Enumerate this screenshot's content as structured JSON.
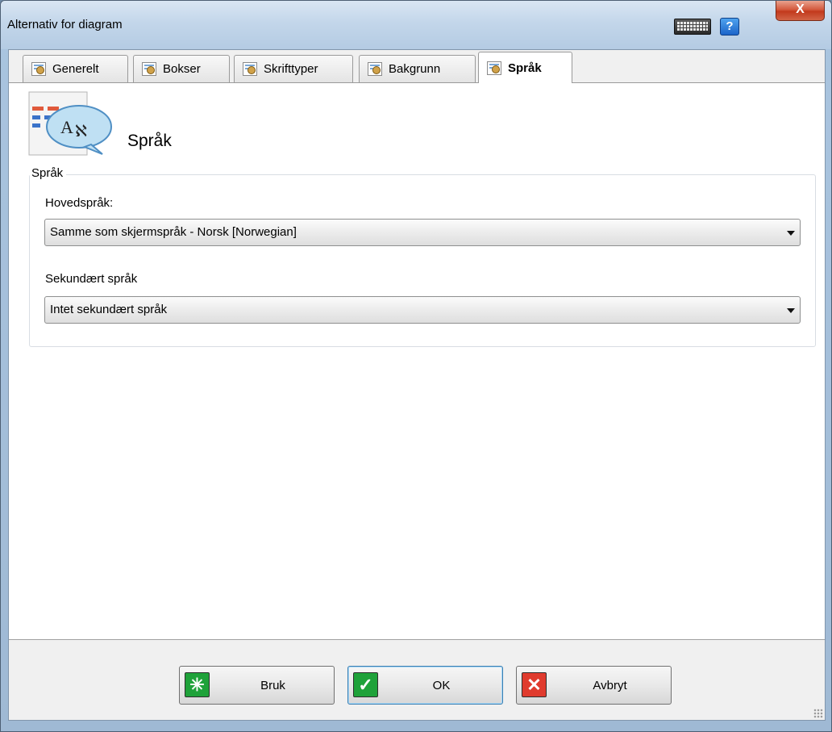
{
  "window": {
    "title": "Alternativ for diagram",
    "help_label": "?",
    "close_label": "X"
  },
  "tabs": [
    {
      "label": "Generelt",
      "active": false
    },
    {
      "label": "Bokser",
      "active": false
    },
    {
      "label": "Skrifttyper",
      "active": false
    },
    {
      "label": "Bakgrunn",
      "active": false
    },
    {
      "label": "Språk",
      "active": true
    }
  ],
  "panel": {
    "title": "Språk",
    "header_icon": "language-translate-icon",
    "group_legend": "Språk",
    "main_language": {
      "label": "Hovedspråk:",
      "value": "Samme som skjermspråk - Norsk [Norwegian]"
    },
    "secondary_language": {
      "label": "Sekundært språk",
      "value": "Intet sekundært språk"
    }
  },
  "buttons": {
    "apply": {
      "label": "Bruk",
      "icon": "apply-icon",
      "color": "#1fa23a"
    },
    "ok": {
      "label": "OK",
      "icon": "checkmark-icon",
      "color": "#1fa23a"
    },
    "cancel": {
      "label": "Avbryt",
      "icon": "close-x-icon",
      "color": "#e03b2e"
    }
  }
}
